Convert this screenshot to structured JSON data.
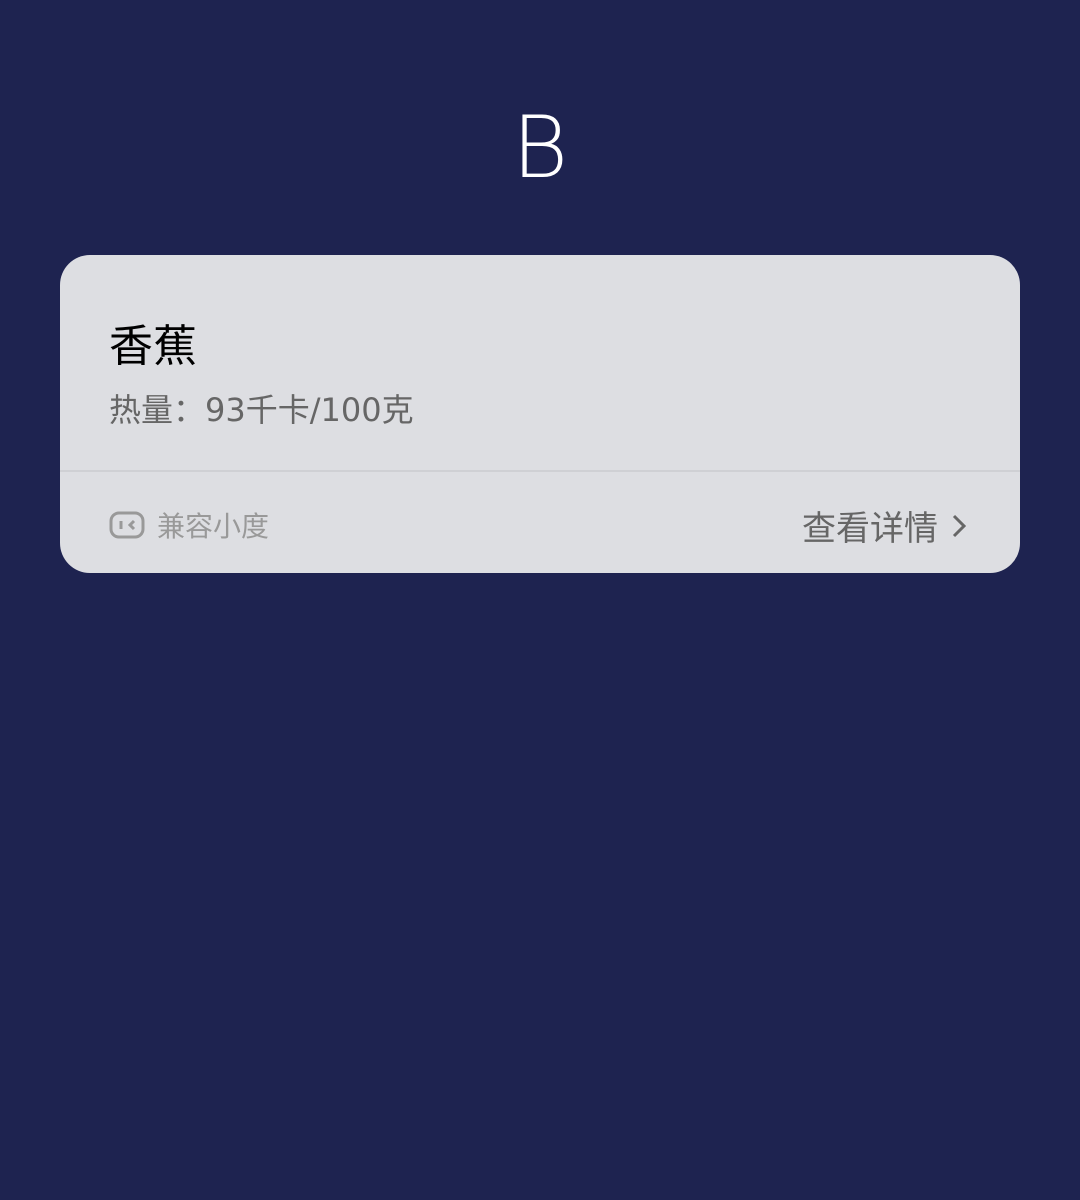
{
  "header": {
    "title": "B"
  },
  "card": {
    "name": "香蕉",
    "calories": "热量：93千卡/100克",
    "compat_label": "兼容小度",
    "detail_label": "查看详情"
  }
}
